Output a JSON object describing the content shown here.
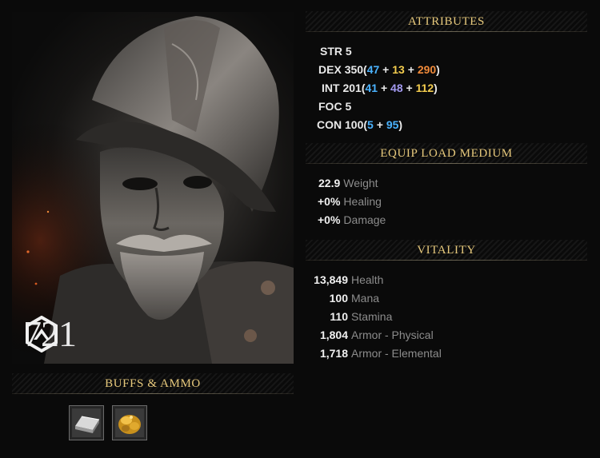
{
  "gear_score": "721",
  "attributes": {
    "title": "ATTRIBUTES",
    "str": {
      "label": "STR",
      "total": "5"
    },
    "dex": {
      "label": "DEX",
      "total": "350",
      "a": "47",
      "b": "13",
      "c": "290"
    },
    "int": {
      "label": "INT",
      "total": "201",
      "a": "41",
      "b": "48",
      "c": "112"
    },
    "foc": {
      "label": "FOC",
      "total": "5"
    },
    "con": {
      "label": "CON",
      "total": "100",
      "a": "5",
      "b": "95"
    }
  },
  "equip_load": {
    "title": "EQUIP LOAD MEDIUM",
    "rows": [
      {
        "value": "22.9",
        "label": "Weight"
      },
      {
        "value": "+0%",
        "label": "Healing"
      },
      {
        "value": "+0%",
        "label": "Damage"
      }
    ]
  },
  "vitality": {
    "title": "VITALITY",
    "rows": [
      {
        "value": "13,849",
        "label": "Health"
      },
      {
        "value": "100",
        "label": "Mana"
      },
      {
        "value": "110",
        "label": "Stamina"
      },
      {
        "value": "1,804",
        "label": "Armor - Physical"
      },
      {
        "value": "1,718",
        "label": "Armor - Elemental"
      }
    ]
  },
  "buffs": {
    "title": "BUFFS & AMMO",
    "slots": [
      {
        "icon": "silver-ingot-icon"
      },
      {
        "icon": "gold-ore-icon"
      }
    ]
  },
  "colors": {
    "header_gold": "#e7c97c",
    "stat_blue": "#4bb3ff",
    "stat_purple": "#a39af0",
    "stat_yellow": "#f4cd4e",
    "stat_orange": "#f08a3a"
  }
}
